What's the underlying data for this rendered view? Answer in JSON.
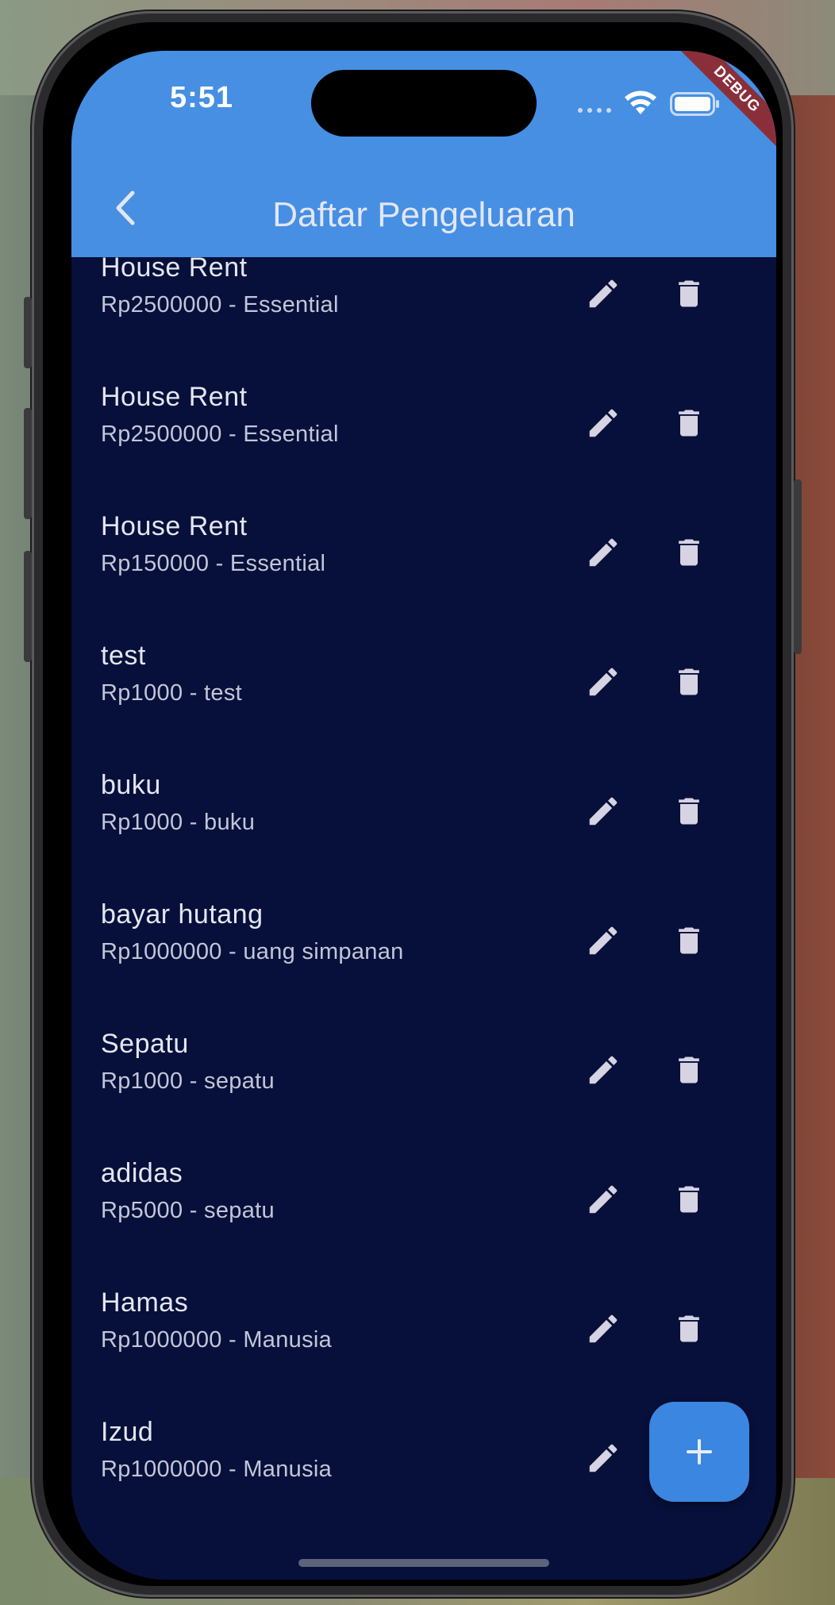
{
  "status_bar": {
    "time": "5:51"
  },
  "debug_banner": "DEBUG",
  "appbar": {
    "title": "Daftar Pengeluaran",
    "color": "#468fe3"
  },
  "expenses": [
    {
      "name": "House Rent",
      "detail": "Rp2500000 - Essential"
    },
    {
      "name": "House Rent",
      "detail": "Rp2500000 - Essential"
    },
    {
      "name": "House Rent",
      "detail": "Rp150000 - Essential"
    },
    {
      "name": "test",
      "detail": "Rp1000 - test"
    },
    {
      "name": "buku",
      "detail": "Rp1000 - buku"
    },
    {
      "name": "bayar hutang",
      "detail": "Rp1000000 - uang simpanan"
    },
    {
      "name": "Sepatu",
      "detail": "Rp1000 - sepatu"
    },
    {
      "name": "adidas",
      "detail": "Rp5000 - sepatu"
    },
    {
      "name": "Hamas",
      "detail": "Rp1000000 - Manusia"
    },
    {
      "name": "Izud",
      "detail": "Rp1000000 - Manusia"
    }
  ],
  "icons": {
    "back": "chevron-left-icon",
    "edit": "pencil-icon",
    "delete": "trash-icon",
    "add": "plus-icon"
  },
  "colors": {
    "background": "#06103a",
    "fab": "#3b86e0",
    "icon": "#d6d3e2"
  }
}
